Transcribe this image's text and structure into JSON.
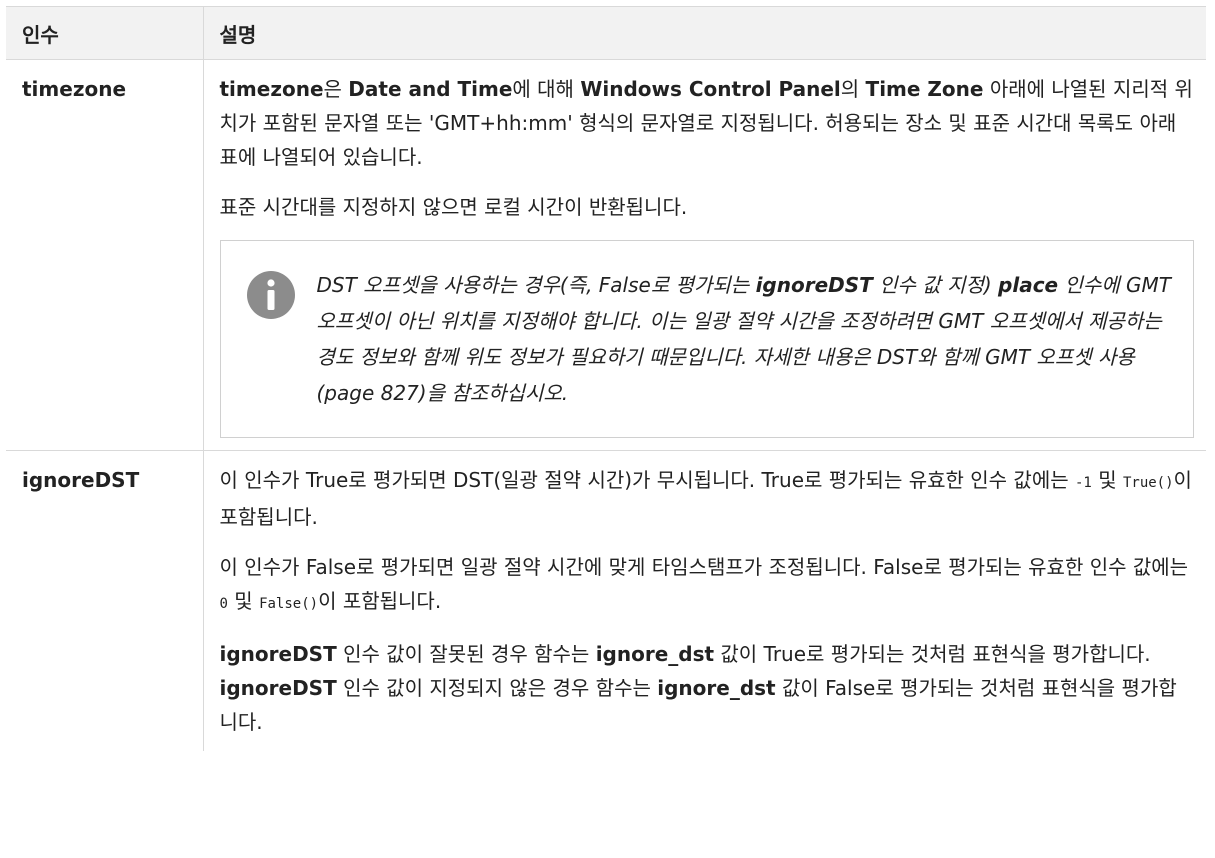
{
  "header": {
    "col_arg": "인수",
    "col_desc": "설명"
  },
  "rows": [
    {
      "arg": "timezone",
      "p1": [
        {
          "t": "timezone",
          "b": true
        },
        {
          "t": "은 "
        },
        {
          "t": "Date and Time",
          "b": true
        },
        {
          "t": "에 대해 "
        },
        {
          "t": "Windows Control Panel",
          "b": true
        },
        {
          "t": "의 "
        },
        {
          "t": "Time Zone",
          "b": true
        },
        {
          "t": " 아래에 나열된 지리적 위치가 포함된 문자열 또는 'GMT+hh:mm' 형식의 문자열로 지정됩니다. 허용되는 장소 및 표준 시간대 목록도 아래 표에 나열되어 있습니다."
        }
      ],
      "p2": "표준 시간대를 지정하지 않으면 로컬 시간이 반환됩니다.",
      "note": [
        {
          "t": "DST 오프셋을 사용하는 경우(즉, False로 평가되는 "
        },
        {
          "t": "ignoreDST",
          "b": true
        },
        {
          "t": " 인수 값 지정) "
        },
        {
          "t": "place",
          "b": true
        },
        {
          "t": " 인수에 GMT 오프셋이 아닌 위치를 지정해야 합니다. 이는 일광 절약 시간을 조정하려면 GMT 오프셋에서 제공하는 경도 정보와 함께 위도 정보가 필요하기 때문입니다. 자세한 내용은 DST와 함께 GMT 오프셋 사용 (page 827)을 참조하십시오."
        }
      ],
      "note_icon": "info-icon"
    },
    {
      "arg": "ignoreDST",
      "p1": [
        {
          "t": "이 인수가 True로 평가되면 DST(일광 절약 시간)가 무시됩니다. True로 평가되는 유효한 인수 값에는 "
        },
        {
          "t": "-1",
          "c": true
        },
        {
          "t": " 및 "
        },
        {
          "t": "True()",
          "c": true
        },
        {
          "t": "이 포함됩니다."
        }
      ],
      "p2": [
        {
          "t": "이 인수가 False로 평가되면 일광 절약 시간에 맞게 타임스탬프가 조정됩니다. False로 평가되는 유효한 인수 값에는 "
        },
        {
          "t": "0",
          "c": true
        },
        {
          "t": " 및 "
        },
        {
          "t": "False()",
          "c": true
        },
        {
          "t": "이 포함됩니다."
        }
      ],
      "p3": [
        {
          "t": "ignoreDST",
          "b": true
        },
        {
          "t": " 인수 값이 잘못된 경우 함수는 "
        },
        {
          "t": "ignore_dst",
          "b": true
        },
        {
          "t": " 값이 True로 평가되는 것처럼 표현식을 평가합니다. "
        },
        {
          "t": "ignoreDST",
          "b": true
        },
        {
          "t": " 인수 값이 지정되지 않은 경우 함수는 "
        },
        {
          "t": "ignore_dst",
          "b": true
        },
        {
          "t": " 값이 False로 평가되는 것처럼 표현식을 평가합니다."
        }
      ]
    }
  ],
  "colors": {
    "header_bg": "#f2f2f2",
    "border": "#d9d9d9",
    "icon_bg": "#8c8c8c"
  }
}
